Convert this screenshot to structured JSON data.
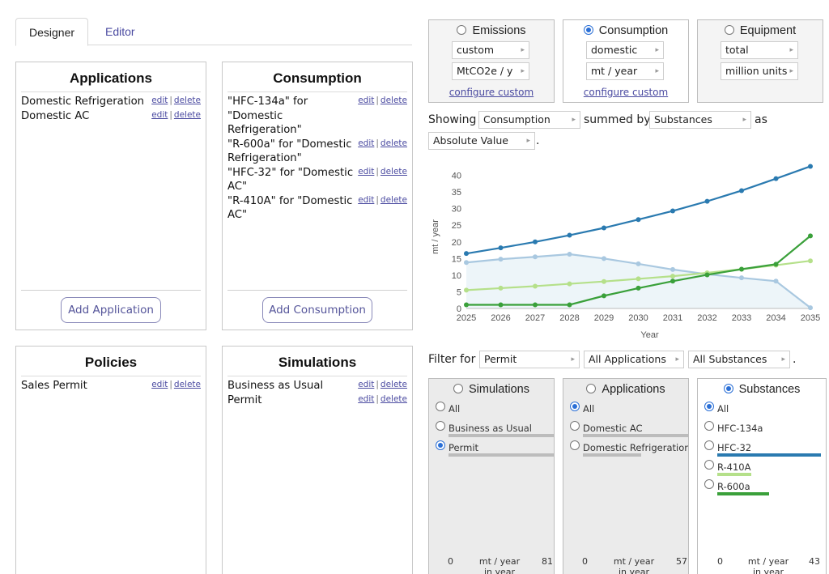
{
  "tabs": [
    {
      "label": "Designer",
      "active": true
    },
    {
      "label": "Editor",
      "active": false
    }
  ],
  "designer": {
    "applications": {
      "title": "Applications",
      "items": [
        "Domestic Refrigeration",
        "Domestic AC"
      ],
      "add_label": "Add Application"
    },
    "consumption": {
      "title": "Consumption",
      "items": [
        "\"HFC-134a\" for \"Domestic Refrigeration\"",
        "\"R-600a\" for \"Domestic Refrigeration\"",
        "\"HFC-32\" for \"Domestic AC\"",
        "\"R-410A\" for \"Domestic AC\""
      ],
      "add_label": "Add Consumption"
    },
    "policies": {
      "title": "Policies",
      "items": [
        "Sales Permit"
      ]
    },
    "simulations": {
      "title": "Simulations",
      "items": [
        "Business as Usual",
        "Permit"
      ]
    },
    "edit_label": "edit",
    "delete_label": "delete",
    "separator": "|"
  },
  "metrics": {
    "emissions": {
      "label": "Emissions",
      "selected": false,
      "select1": "custom",
      "select2": "MtCO2e / y",
      "link": "configure custom"
    },
    "consumption": {
      "label": "Consumption",
      "selected": true,
      "select1": "domestic",
      "select2": "mt / year",
      "link": "configure custom"
    },
    "equipment": {
      "label": "Equipment",
      "selected": false,
      "select1": "total",
      "select2": "million units"
    }
  },
  "showing": {
    "prefix": "Showing",
    "metric": "Consumption",
    "summed_by_label": "summed by",
    "group": "Substances",
    "as_label": "as",
    "mode": "Absolute Value",
    "period": "."
  },
  "filter": {
    "label": "Filter for",
    "simulation": "Permit",
    "application": "All Applications",
    "substance": "All Substances",
    "period": "."
  },
  "filter_cards": {
    "simulations": {
      "title": "Simulations",
      "selected": false,
      "options": [
        {
          "label": "All",
          "checked": false,
          "bar": 0
        },
        {
          "label": "Business as Usual",
          "checked": false,
          "bar": 1.0
        },
        {
          "label": "Permit",
          "checked": true,
          "bar": 1.0
        }
      ],
      "min": "0",
      "unit": "mt / year\nin year",
      "max": "81"
    },
    "applications": {
      "title": "Applications",
      "selected": false,
      "options": [
        {
          "label": "All",
          "checked": true,
          "bar": 0
        },
        {
          "label": "Domestic AC",
          "checked": false,
          "bar": 1.0
        },
        {
          "label": "Domestic Refrigeration",
          "checked": false,
          "bar": 0.55
        }
      ],
      "min": "0",
      "unit": "mt / year\nin year",
      "max": "57"
    },
    "substances": {
      "title": "Substances",
      "selected": true,
      "options": [
        {
          "label": "All",
          "checked": true,
          "bar": 0,
          "color": ""
        },
        {
          "label": "HFC-134a",
          "checked": false,
          "bar": 0,
          "color": ""
        },
        {
          "label": "HFC-32",
          "checked": false,
          "bar": 1.0,
          "color": "#2a7ab0"
        },
        {
          "label": "R-410A",
          "checked": false,
          "bar": 0.33,
          "color": "#b5e08a"
        },
        {
          "label": "R-600a",
          "checked": false,
          "bar": 0.5,
          "color": "#3aa03a"
        }
      ],
      "min": "0",
      "unit": "mt / year\nin year",
      "max": "43"
    }
  },
  "chart_data": {
    "type": "line",
    "x": [
      2025,
      2026,
      2027,
      2028,
      2029,
      2030,
      2031,
      2032,
      2033,
      2034,
      2035
    ],
    "xlabel": "Year",
    "ylabel": "mt / year",
    "ylim": [
      0,
      45
    ],
    "yticks": [
      0,
      5,
      10,
      15,
      20,
      25,
      30,
      35,
      40
    ],
    "grid": false,
    "series": [
      {
        "name": "HFC-32",
        "color": "#2a7ab0",
        "values": [
          16.5,
          18.2,
          20.0,
          22.0,
          24.2,
          26.7,
          29.3,
          32.2,
          35.4,
          39.0,
          42.7
        ]
      },
      {
        "name": "HFC-134a",
        "color": "#a9c8e0",
        "values": [
          13.8,
          14.8,
          15.5,
          16.3,
          15.0,
          13.4,
          11.7,
          10.3,
          9.2,
          8.2,
          0.2
        ]
      },
      {
        "name": "R-410A",
        "color": "#b5e08a",
        "values": [
          5.5,
          6.1,
          6.7,
          7.4,
          8.1,
          8.9,
          9.7,
          10.7,
          11.8,
          13.0,
          14.3
        ]
      },
      {
        "name": "R-600a",
        "color": "#3aa03a",
        "values": [
          1.1,
          1.1,
          1.1,
          1.1,
          3.8,
          6.1,
          8.2,
          10.1,
          11.8,
          13.3,
          21.8
        ]
      }
    ]
  }
}
